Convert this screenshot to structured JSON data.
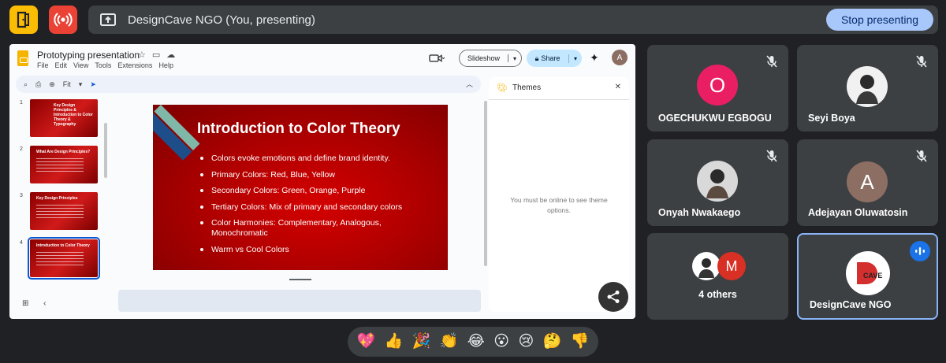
{
  "topbar": {
    "exit_icon": "door-exit-icon",
    "record_icon": "broadcast-icon",
    "present_icon": "present-screen-icon",
    "presenting_title": "DesignCave NGO (You, presenting)",
    "stop_label": "Stop presenting",
    "accent": "#a8c7fa"
  },
  "slides_app": {
    "title": "Prototyping presentation",
    "menu": [
      "File",
      "Edit",
      "View",
      "Tools",
      "Extensions",
      "Help"
    ],
    "slideshow_label": "Slideshow",
    "share_label": "Share",
    "account_initial": "A",
    "zoom": "Fit",
    "thumbnails": [
      {
        "num": "1",
        "title": "Key Design Principles & Introduction to Color Theory & Typography"
      },
      {
        "num": "2",
        "title": "What Are Design Principles?"
      },
      {
        "num": "3",
        "title": "Key Design Principles"
      },
      {
        "num": "4",
        "title": "Introduction to Color Theory"
      }
    ],
    "current_slide": {
      "title": "Introduction to Color Theory",
      "bullets": [
        "Colors evoke emotions and define brand identity.",
        "Primary Colors: Red, Blue, Yellow",
        "Secondary Colors: Green, Orange, Purple",
        "Tertiary Colors: Mix of primary and secondary colors",
        "Color Harmonies: Complementary, Analogous, Monochromatic",
        "Warm vs Cool Colors"
      ]
    },
    "themes": {
      "title": "Themes",
      "message": "You must be online to see theme options."
    }
  },
  "participants": [
    {
      "name": "OGECHUKWU EGBOGU",
      "initial": "O",
      "color": "#e91e63",
      "muted": true
    },
    {
      "name": "Seyi Boya",
      "initial": "",
      "muted": true
    },
    {
      "name": "Onyah Nwakaego",
      "initial": "",
      "muted": true
    },
    {
      "name": "Adejayan Oluwatosin",
      "initial": "A",
      "color": "#8d6e63",
      "muted": true
    },
    {
      "name": "4 others",
      "initial": "M",
      "color": "#d93025"
    },
    {
      "name": "DesignCave NGO",
      "logo_text": "CAVE",
      "speaking": true
    }
  ],
  "reactions": [
    "💖",
    "👍",
    "🎉",
    "👏",
    "😂",
    "😮",
    "😢",
    "🤔",
    "👎"
  ]
}
